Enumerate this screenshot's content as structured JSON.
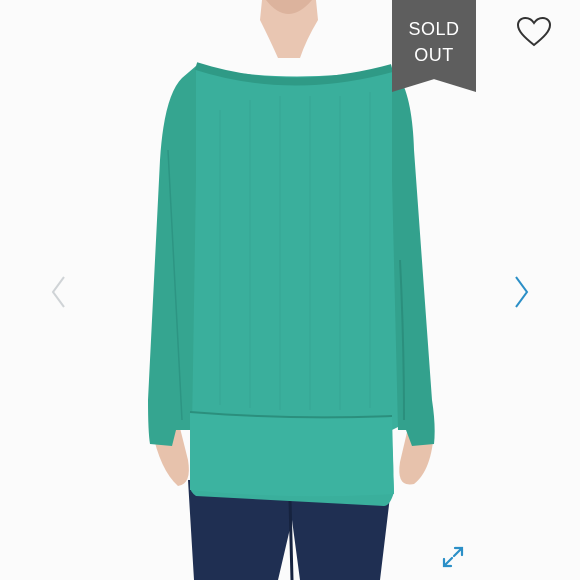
{
  "product_image": {
    "icon": "product-photo",
    "garment_color": "#3aaf9c",
    "jeans_color": "#1f2f52"
  },
  "badge": {
    "line1": "SOLD",
    "line2": "OUT",
    "color": "#5e5e5e"
  },
  "controls": {
    "favorite_icon": "heart-icon",
    "prev_icon": "chevron-left-icon",
    "next_icon": "chevron-right-icon",
    "expand_icon": "expand-icon",
    "prev_color": "#cfd3d6",
    "next_color": "#2b8fc7",
    "expand_color": "#2b8fc7"
  }
}
